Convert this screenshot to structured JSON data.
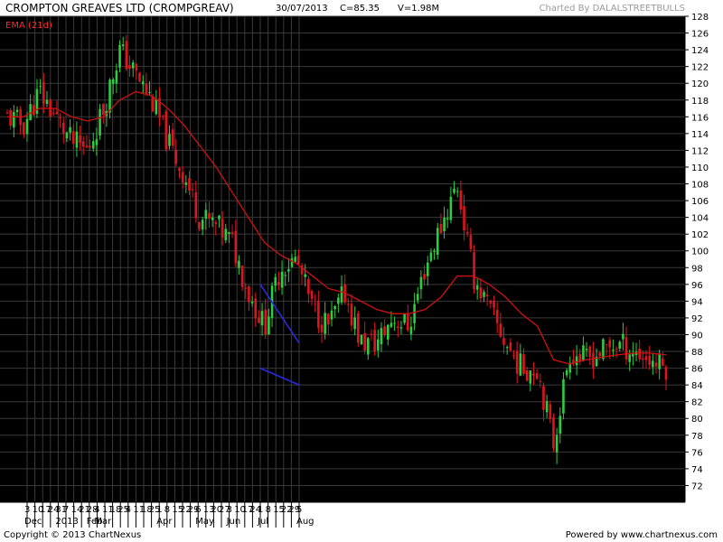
{
  "header": {
    "title": "CROMPTON GREAVES LTD (CROMPGREAV)",
    "date": "30/07/2013",
    "close": "C=85.35",
    "volume": "V=1.98M",
    "credit": "Charted By DALALSTREETBULLS"
  },
  "footer": {
    "copyright": "Copyright © 2013 ChartNexus",
    "powered": "Powered by www.chartnexus.com"
  },
  "colors": {
    "background": "#000000",
    "grid": "#3a3a3a",
    "up": "#2ecc40",
    "down": "#e0141e",
    "ema": "#d01010",
    "trendline": "#2a2ae0"
  },
  "chart_data": {
    "type": "candlestick",
    "legend": "EMA (21d)",
    "ylim": [
      70,
      128
    ],
    "y_ticks": [
      72,
      74,
      76,
      78,
      80,
      82,
      84,
      86,
      88,
      90,
      92,
      94,
      96,
      98,
      100,
      102,
      104,
      106,
      108,
      110,
      112,
      114,
      116,
      118,
      120,
      122,
      124,
      126,
      128
    ],
    "x_day_labels": [
      "3",
      "10",
      "17",
      "24",
      "31",
      "7",
      "14",
      "21",
      "28",
      "4",
      "11",
      "18",
      "25",
      "4",
      "11",
      "18",
      "25",
      "1",
      "8",
      "15",
      "22",
      "29",
      "6",
      "13",
      "20",
      "27",
      "3",
      "10",
      "17",
      "24",
      "1",
      "8",
      "15",
      "22",
      "29",
      "5"
    ],
    "x_month_labels": [
      {
        "label": "Dec",
        "at": "3"
      },
      {
        "label": "2013",
        "at": "31"
      },
      {
        "label": "Feb",
        "at": "28"
      },
      {
        "label": "Mar",
        "at": "4"
      },
      {
        "label": "Apr",
        "at": "1"
      },
      {
        "label": "May",
        "at": "6"
      },
      {
        "label": "Jun",
        "at": "3"
      },
      {
        "label": "Jul",
        "at": "1"
      },
      {
        "label": "Aug",
        "at": "5"
      }
    ],
    "weekly_close": [
      116,
      115,
      119,
      116,
      113,
      112,
      117,
      124,
      121,
      118,
      113,
      109,
      104,
      103,
      101,
      95,
      91,
      98,
      99,
      93,
      91,
      95,
      89,
      89,
      92,
      91,
      98,
      103,
      108,
      97,
      93,
      89,
      86,
      86,
      77,
      88,
      87,
      88,
      89,
      88,
      87,
      86
    ],
    "ema_21": [
      116,
      116,
      117,
      117,
      116,
      115.5,
      116,
      118,
      119,
      118.5,
      117,
      115,
      112.5,
      110,
      107,
      104,
      101,
      99.5,
      98.5,
      97,
      95.5,
      95,
      94,
      93,
      92.5,
      92.5,
      93,
      94.5,
      97,
      97,
      96,
      94.5,
      92.5,
      91,
      87,
      86.5,
      87,
      87.3,
      87.6,
      87.8,
      87.8,
      87.6
    ],
    "trendlines": [
      {
        "from": {
          "date": "1 Jul",
          "value": 96
        },
        "to": {
          "date": "5 Aug",
          "value": 89
        }
      },
      {
        "from": {
          "date": "1 Jul",
          "value": 86
        },
        "to": {
          "date": "5 Aug",
          "value": 84
        }
      }
    ]
  }
}
